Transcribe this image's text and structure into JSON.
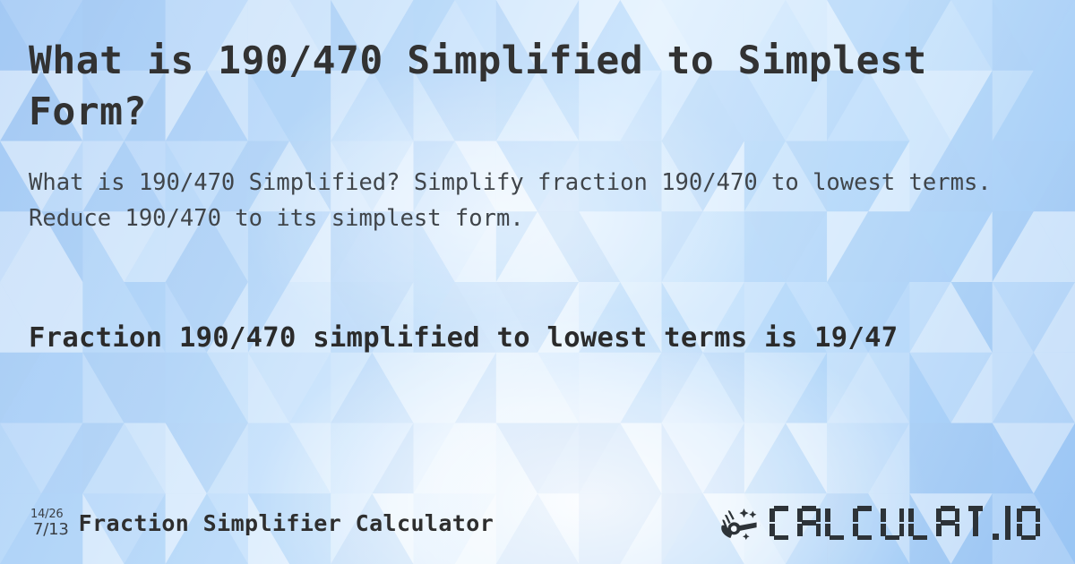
{
  "meta": {
    "accent_blue": "#a9cdf6",
    "text_dark": "#323232",
    "text_body": "#40454a",
    "logo_color": "#2d3338"
  },
  "header": {
    "title": "What is 190/470 Simplified to Simplest Form?"
  },
  "description": {
    "text": "What is 190/470 Simplified? Simplify fraction 190/470 to lowest terms. Reduce 190/470 to its simplest form."
  },
  "result": {
    "text": "Fraction 190/470 simplified to lowest terms is 19/47"
  },
  "footer": {
    "fraction_icon": {
      "numerator_example": "14/26",
      "denominator_example": "7/13"
    },
    "brand_label": "Fraction Simplifier Calculator",
    "logo": {
      "wordmark": "CALCULAT.IO",
      "icon": "hand-magic-wand-icon"
    }
  }
}
